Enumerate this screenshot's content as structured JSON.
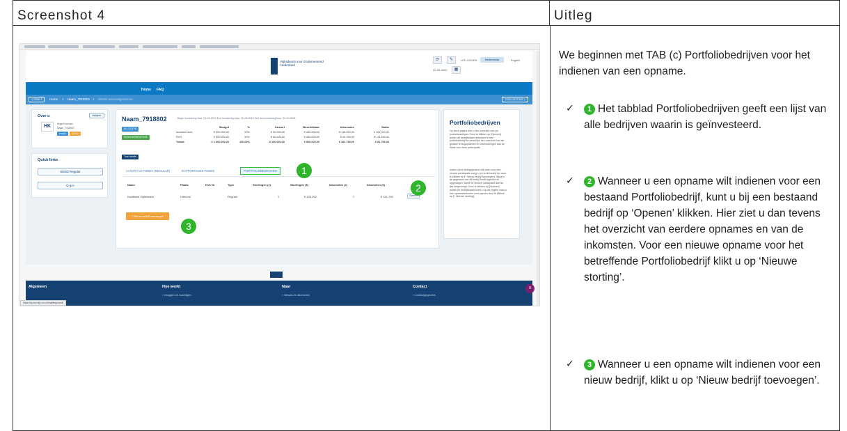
{
  "headers": {
    "left": "Screenshot 4",
    "right": "Uitleg"
  },
  "screenshot": {
    "logo_text": "Rijksdienst voor Ondernemend Nederland",
    "header_date": "30-09-2020",
    "logout_label": "UITLOGGEN",
    "lang_active": "Nederlands",
    "lang_other": "English",
    "nav": [
      "Home",
      "FAQ"
    ],
    "breadcrumb": [
      "< PRINT",
      "Home",
      ">",
      "Naam_7918802",
      ">",
      "DEMO aanvraagnummer"
    ],
    "breadcrumb_button": "TOELICHTING >",
    "over_u": {
      "title": "Over u",
      "edit_label": "Bekijken",
      "initials": "HK",
      "name": "Hugo Koornan",
      "org": "Naam_7918WZ",
      "badges": [
        "FONDS",
        "ACTIEF"
      ]
    },
    "quick_links": {
      "title": "Quick links",
      "items": [
        "SEED Regular",
        "Q & A"
      ]
    },
    "main": {
      "title": "Naam_7918802",
      "meta": "Begin investering fase: 01-01-2020  End investering fase: 30-06-2024  End desinvestering fase: 31-12-2028",
      "badges": [
        "ALLOCATIE",
        "INVESTERINGSFASE"
      ],
      "next_button": "Toon details",
      "fin_columns": [
        "Budget",
        "%",
        "Gestort",
        "Beschikbaar",
        "Inkomsten",
        "Saldo"
      ],
      "fin_rows": [
        {
          "label": "Investeerders:",
          "values": [
            "€ 500.000,00",
            "50%",
            "€ 50.000,00",
            "€ 450.000,00",
            "€ 116.000,00",
            "€ 106.000,00"
          ]
        },
        {
          "label": "RVO:",
          "values": [
            "€ 500.000,00",
            "50%",
            "€ 50.000,00",
            "€ 450.000,00",
            "€ 25.750,00",
            "€ -24.250,00"
          ]
        },
        {
          "label": "Totaal:",
          "values": [
            "€ 1.000.000,00",
            "100.00%",
            "€ 100.000,00",
            "€ 900.000,00",
            "€ 181.750,00",
            "€ 81.750,00"
          ]
        }
      ]
    },
    "tabs": [
      "AANVRAAG FONDS (REGULAR)",
      "RAPPORTAGES FONDS",
      "PORTFOLIOBEDRIJVEN"
    ],
    "table": {
      "headers": [
        "Naam",
        "Plaats",
        "KvK Nr",
        "Type",
        "Stortingen (#)",
        "Stortingen (€)",
        "Inkomsten (#)",
        "Inkomsten (€)"
      ],
      "row": [
        "Kwalitaria Zijdeweard",
        "Uithoorn",
        "",
        "Regular",
        "1",
        "€ 100.000",
        "7",
        "€ 181.750"
      ],
      "open_label": "Openen",
      "add_label": "+ Nieuw bedrijf toevoegen"
    },
    "sidebar": {
      "title": "Portfoliobedrijven",
      "text1": "Op deze pagina ziet u een overzicht van uw portfoliobedrijven. Door te klikken op [Openen] achter de bedrijfsnaam selecteert u een portfoliobedrijf en verschijnt een overzicht van de gedane leningopnames en overboekingen aan de Staat voor deze participatie.",
      "text2": "Indien u een leningopname wilt doen voor een nieuwe participatie voegt u eerst dit bedrijf toe door te klikken op [+ Nieuw bedrijf toevoegen]. Nadat u de gegevens van dit bedrijf heeft ingevuld en opgeslagen, wordt de nieuwe participatie aan de lijst toegevoegd. Door te klikken op [Openen] achter de bedrijfsnaam komt u op de pagina waar u een opnameformulier kunt openen door te klikken op [+ Nieuwe storting]."
    },
    "footer": {
      "cols": [
        {
          "head": "Algemeen",
          "link": "Over ons"
        },
        {
          "head": "Hoe werkt",
          "link": "> Inloggen en machtigen"
        },
        {
          "head": "Naar",
          "link": "> Nieuws en abonneren"
        },
        {
          "head": "Contact",
          "link": "> Contactgegevens"
        }
      ],
      "chat_label": "0"
    },
    "status_url": "https://bp-tst.mijn.rvo.nl/regeling/seedfl"
  },
  "markers": [
    "1",
    "2",
    "3"
  ],
  "uitleg": {
    "intro": "We beginnen met TAB (c) Portfoliobedrijven voor het indienen van een opname.",
    "check": "✓",
    "items": [
      {
        "num": "1",
        "text": "Het tabblad Portfoliobedrijven geeft een lijst van alle bedrijven waarin is geïnvesteerd."
      },
      {
        "num": "2",
        "text": "Wanneer u een opname wilt indienen voor een bestaand Portfoliobedrijf, kunt u bij een bestaand bedrijf op ‘Openen’ klikken. Hier ziet u dan tevens het overzicht van eerdere opnames en van de inkomsten. Voor een nieuwe opname voor het betreffende Portfoliobedrijf klikt u op ‘Nieuwe storting’."
      },
      {
        "num": "3",
        "text": "Wanneer u een opname wilt indienen voor een nieuw bedrijf, klikt u op ‘Nieuw bedrijf toevoegen’."
      }
    ]
  }
}
